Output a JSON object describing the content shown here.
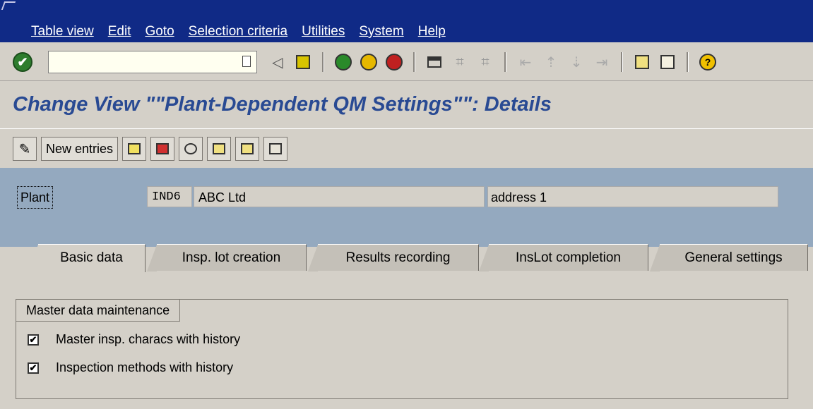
{
  "menu": {
    "items": [
      {
        "label": "Table view"
      },
      {
        "label": "Edit"
      },
      {
        "label": "Goto"
      },
      {
        "label": "Selection criteria"
      },
      {
        "label": "Utilities"
      },
      {
        "label": "System"
      },
      {
        "label": "Help"
      }
    ]
  },
  "toolbar": {
    "command_value": "",
    "icons": [
      "enter-icon",
      "back-arrow-icon",
      "save-icon",
      "back-icon",
      "exit-icon",
      "cancel-icon",
      "print-icon",
      "find-icon",
      "find-next-icon",
      "first-page-icon",
      "previous-page-icon",
      "next-page-icon",
      "last-page-icon",
      "create-session-icon",
      "shortcut-icon",
      "help-icon"
    ]
  },
  "title": "Change View \"\"Plant-Dependent QM Settings\"\": Details",
  "appbar": {
    "new_entries": "New entries"
  },
  "plant": {
    "label": "Plant",
    "code": "IND6",
    "name": "ABC Ltd",
    "address": "address 1"
  },
  "tabs": [
    {
      "label": "Basic data",
      "active": true
    },
    {
      "label": "Insp. lot creation",
      "active": false
    },
    {
      "label": "Results recording",
      "active": false
    },
    {
      "label": "InsLot completion",
      "active": false
    },
    {
      "label": "General settings",
      "active": false
    }
  ],
  "group": {
    "title": "Master data maintenance",
    "options": [
      {
        "label": "Master insp. characs with history",
        "checked": true
      },
      {
        "label": "Inspection methods with history",
        "checked": true
      }
    ]
  },
  "colors": {
    "menubar": "#102a86",
    "title": "#294a93",
    "header": "#94a9bf",
    "background": "#d4d0c8"
  }
}
